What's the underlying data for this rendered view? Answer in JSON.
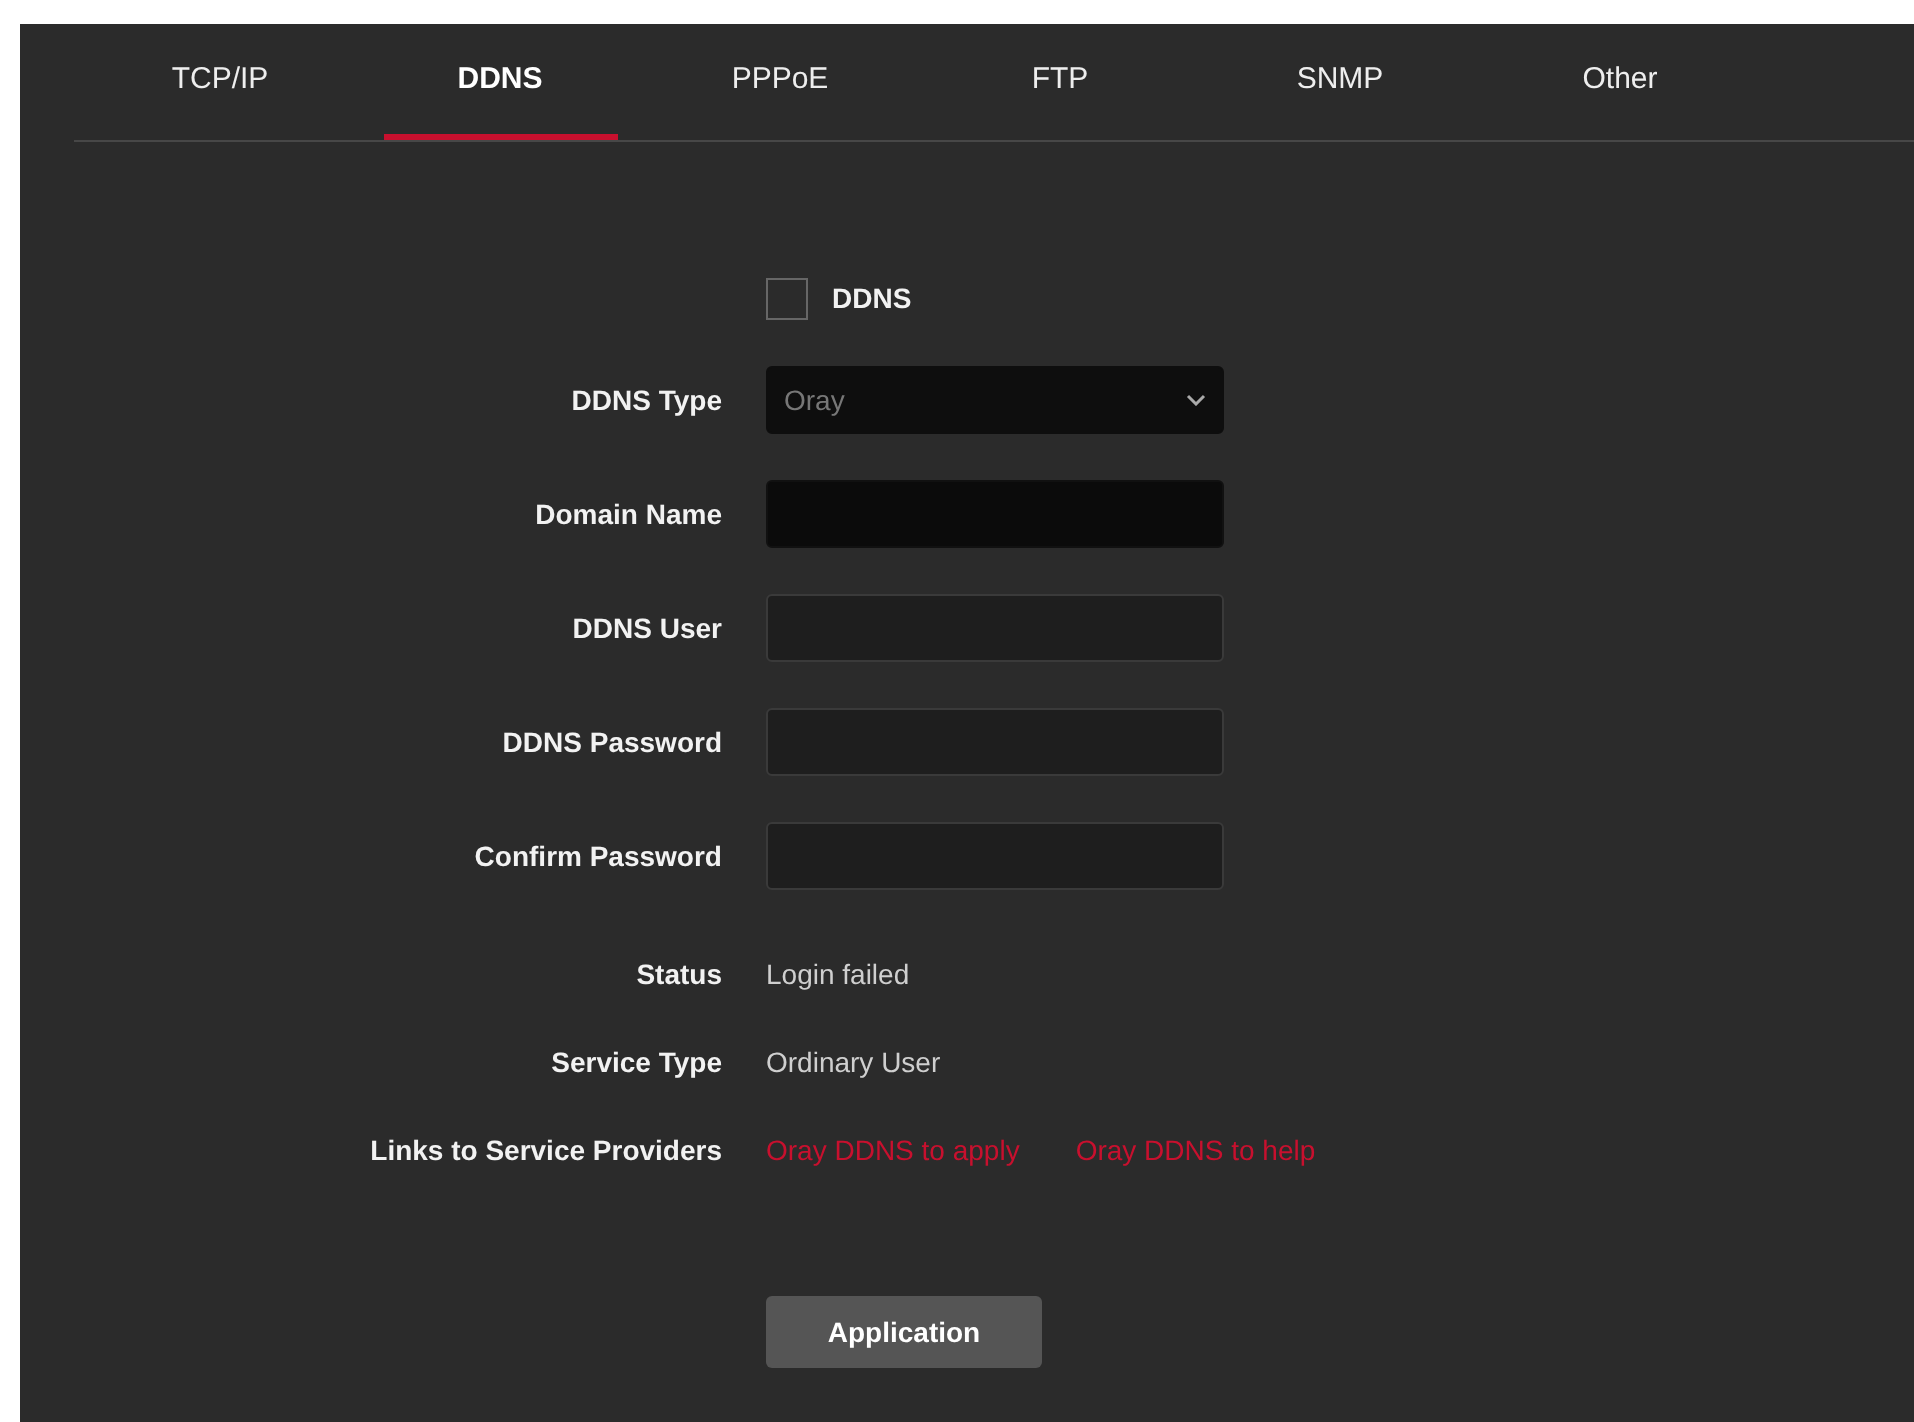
{
  "tabs": [
    {
      "label": "TCP/IP",
      "selected": false
    },
    {
      "label": "DDNS",
      "selected": true
    },
    {
      "label": "PPPoE",
      "selected": false
    },
    {
      "label": "FTP",
      "selected": false
    },
    {
      "label": "SNMP",
      "selected": false
    },
    {
      "label": "Other",
      "selected": false
    }
  ],
  "form": {
    "enable": {
      "label": "DDNS",
      "checked": false
    },
    "fields": [
      {
        "kind": "select",
        "label": "DDNS Type",
        "value": "Oray",
        "disabled": true,
        "focused": false
      },
      {
        "kind": "input",
        "label": "Domain Name",
        "focused": true
      },
      {
        "kind": "input",
        "label": "DDNS User",
        "focused": false
      },
      {
        "kind": "input",
        "label": "DDNS Password",
        "focused": false
      },
      {
        "kind": "input",
        "label": "Confirm Password",
        "focused": false
      }
    ],
    "info": [
      {
        "label": "Status",
        "value": "Login failed"
      },
      {
        "label": "Service Type",
        "value": "Ordinary User"
      }
    ],
    "links": {
      "label": "Links to Service Providers",
      "items": [
        "Oray DDNS to apply",
        "Oray DDNS to help"
      ]
    },
    "button": "Application"
  }
}
